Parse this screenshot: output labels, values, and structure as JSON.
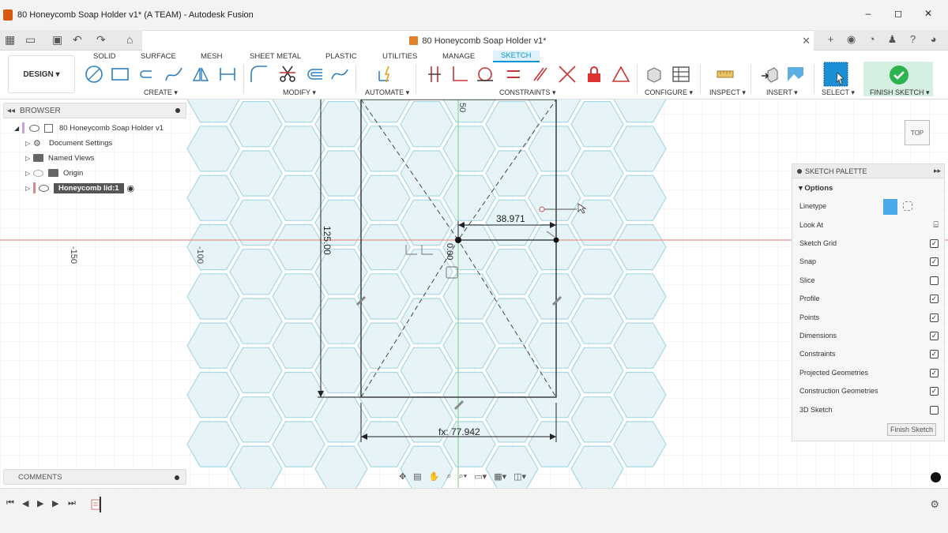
{
  "window": {
    "title": "80 Honeycomb Soap Holder v1* (A TEAM) - Autodesk Fusion",
    "minimize": "–",
    "maximize": "◻",
    "close": "✕"
  },
  "document_tab": {
    "label": "80 Honeycomb Soap Holder v1*",
    "close": "✕"
  },
  "toolbar": {
    "workspace_button": "DESIGN ▾",
    "workspace_tabs": [
      "SOLID",
      "SURFACE",
      "MESH",
      "SHEET METAL",
      "PLASTIC",
      "UTILITIES",
      "MANAGE",
      "SKETCH"
    ],
    "active_tab": "SKETCH",
    "groups": {
      "create": "CREATE ▾",
      "modify": "MODIFY ▾",
      "automate": "AUTOMATE ▾",
      "constraints": "CONSTRAINTS ▾",
      "configure": "CONFIGURE ▾",
      "inspect": "INSPECT ▾",
      "insert": "INSERT ▾",
      "select": "SELECT ▾",
      "finish_sketch": "FINISH SKETCH ▾"
    }
  },
  "browser": {
    "header": "BROWSER",
    "root": "80 Honeycomb Soap Holder v1",
    "items": [
      {
        "label": "Document Settings"
      },
      {
        "label": "Named Views"
      },
      {
        "label": "Origin"
      },
      {
        "label": "Honeycomb lid:1"
      }
    ]
  },
  "comments": {
    "header": "COMMENTS"
  },
  "canvas": {
    "axis_labels": {
      "x_neg150": "-150",
      "x_neg100": "-100",
      "y50": "50"
    },
    "dimensions": {
      "width_top": "38.971",
      "width_bottom": "fx: 77.942",
      "height": "125.00",
      "small": "0.00"
    }
  },
  "viewcube": {
    "label": "TOP"
  },
  "palette": {
    "header": "SKETCH PALETTE",
    "options_title": "Options",
    "linetype": "Linetype",
    "look_at": "Look At",
    "options": [
      {
        "label": "Sketch Grid",
        "checked": true
      },
      {
        "label": "Snap",
        "checked": true
      },
      {
        "label": "Slice",
        "checked": false
      },
      {
        "label": "Profile",
        "checked": true
      },
      {
        "label": "Points",
        "checked": true
      },
      {
        "label": "Dimensions",
        "checked": true
      },
      {
        "label": "Constraints",
        "checked": true
      },
      {
        "label": "Projected Geometries",
        "checked": true
      },
      {
        "label": "Construction Geometries",
        "checked": true
      },
      {
        "label": "3D Sketch",
        "checked": false
      }
    ],
    "finish_button": "Finish Sketch"
  },
  "colors": {
    "accent": "#0696d7",
    "hex_fill": "#e6f4f8",
    "hex_stroke": "#a9d8e3",
    "axis_red": "#e57a7a",
    "axis_green": "#7dcf7d"
  }
}
